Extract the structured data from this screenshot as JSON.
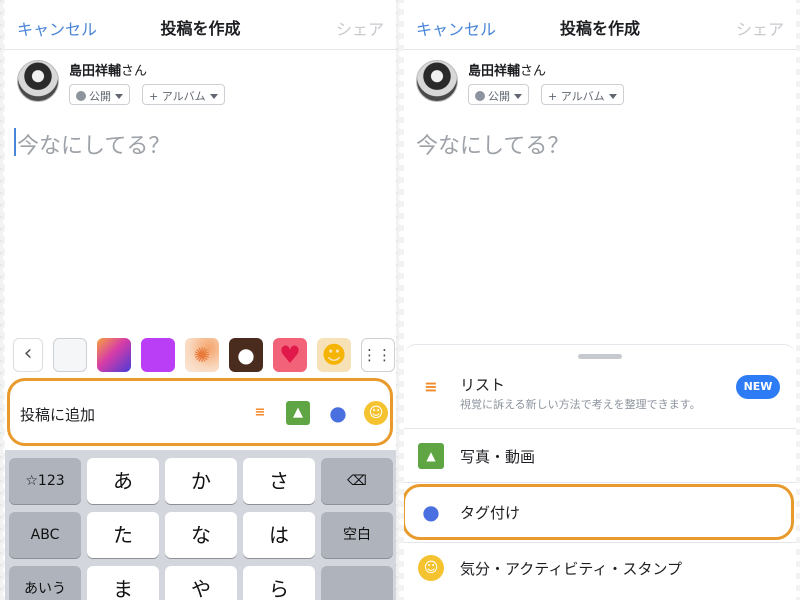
{
  "left": {
    "header": {
      "cancel": "キャンセル",
      "title": "投稿を作成",
      "share": "シェア"
    },
    "user": {
      "name": "島田祥輔",
      "suffix": "さん",
      "privacy": "公開",
      "album": "+ アルバム"
    },
    "composer": {
      "placeholder": "今なにしてる？"
    },
    "swatches": {
      "back": "‹",
      "grid": "⋮⋮⋮"
    },
    "add_bar": {
      "label": "投稿に追加",
      "icons": [
        "list-icon",
        "photo-icon",
        "tag-person-icon",
        "mood-icon"
      ]
    },
    "keyboard": {
      "row1": [
        "☆123",
        "あ",
        "か",
        "さ",
        "⌫"
      ],
      "row2": [
        "ABC",
        "た",
        "な",
        "は",
        "空白"
      ],
      "row3": [
        "あいう",
        "ま",
        "や",
        "ら",
        ""
      ]
    }
  },
  "right": {
    "header": {
      "cancel": "キャンセル",
      "title": "投稿を作成",
      "share": "シェア"
    },
    "user": {
      "name": "島田祥輔",
      "suffix": "さん",
      "privacy": "公開",
      "album": "+ アルバム"
    },
    "composer": {
      "placeholder": "今なにしてる？"
    },
    "sheet": {
      "items": [
        {
          "title": "リスト",
          "subtitle": "視覚に訴える新しい方法で考えを整理できます。",
          "badge": "NEW",
          "icon": "list-icon"
        },
        {
          "title": "写真・動画",
          "icon": "photo-icon"
        },
        {
          "title": "タグ付け",
          "icon": "tag-person-icon"
        },
        {
          "title": "気分・アクティビティ・スタンプ",
          "icon": "mood-icon"
        }
      ]
    }
  },
  "colors": {
    "accent": "#4a86d8",
    "highlight": "#e89a2c",
    "new_badge": "#2d7cf6"
  }
}
